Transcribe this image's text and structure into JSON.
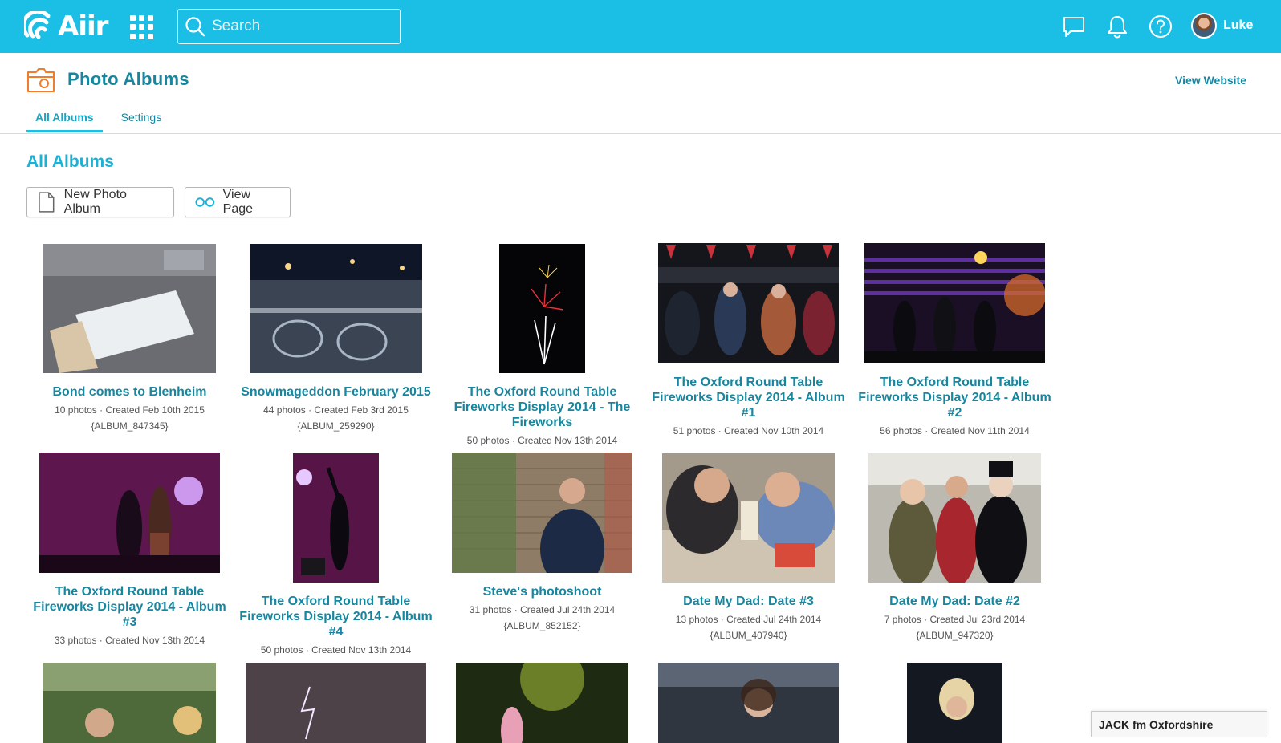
{
  "app": {
    "brand": "Aiir",
    "search_placeholder": "Search",
    "user_name": "Luke",
    "icons": [
      "apps-grid-icon",
      "search-icon",
      "chat-icon",
      "bell-icon",
      "help-icon"
    ]
  },
  "header": {
    "title": "Photo Albums",
    "view_website": "View Website",
    "tabs": [
      {
        "label": "All Albums",
        "active": true
      },
      {
        "label": "Settings",
        "active": false
      }
    ]
  },
  "main": {
    "section_title": "All Albums",
    "buttons": {
      "new_album": "New Photo Album",
      "view_page": "View Page"
    },
    "albums": [
      {
        "title": "Bond comes to Blenheim",
        "meta": "10 photos · Created Feb 10th 2015",
        "token": "{ALBUM_847345}",
        "photo": "grey"
      },
      {
        "title": "Snowmageddon February 2015",
        "meta": "44 photos · Created Feb 3rd 2015",
        "token": "{ALBUM_259290}",
        "photo": "snow"
      },
      {
        "title": "The Oxford Round Table Fireworks Display 2014 - The Fireworks",
        "meta": "50 photos · Created Nov 13th 2014",
        "token": "",
        "photo": "fireworks"
      },
      {
        "title": "The Oxford Round Table Fireworks Display 2014 - Album #1",
        "meta": "51 photos · Created Nov 10th 2014",
        "token": "",
        "photo": "crowd"
      },
      {
        "title": "The Oxford Round Table Fireworks Display 2014 - Album #2",
        "meta": "56 photos · Created Nov 11th 2014",
        "token": "",
        "photo": "stage"
      },
      {
        "title": "The Oxford Round Table Fireworks Display 2014 - Album #3",
        "meta": "33 photos · Created Nov 13th 2014",
        "token": "",
        "photo": "purple"
      },
      {
        "title": "The Oxford Round Table Fireworks Display 2014 - Album #4",
        "meta": "50 photos · Created Nov 13th 2014",
        "token": "",
        "photo": "purple2"
      },
      {
        "title": "Steve's photoshoot",
        "meta": "31 photos · Created Jul 24th 2014",
        "token": "{ALBUM_852152}",
        "photo": "brick"
      },
      {
        "title": "Date My Dad: Date #3",
        "meta": "13 photos · Created Jul 24th 2014",
        "token": "{ALBUM_407940}",
        "photo": "date3"
      },
      {
        "title": "Date My Dad: Date #2",
        "meta": "7 photos · Created Jul 23rd 2014",
        "token": "{ALBUM_947320}",
        "photo": "date2"
      },
      {
        "title": "",
        "meta": "",
        "token": "",
        "photo": "trees"
      },
      {
        "title": "",
        "meta": "",
        "token": "",
        "photo": "lightning"
      },
      {
        "title": "",
        "meta": "",
        "token": "",
        "photo": "green"
      },
      {
        "title": "",
        "meta": "",
        "token": "",
        "photo": "singer"
      },
      {
        "title": "",
        "meta": "",
        "token": "",
        "photo": "singer2"
      }
    ]
  },
  "footer_badge": "JACK fm Oxfordshire",
  "colors": {
    "topbar": "#1bbfe6",
    "link": "#17869f",
    "accent": "#1bb2d6",
    "folder_icon": "#f07d2e"
  }
}
